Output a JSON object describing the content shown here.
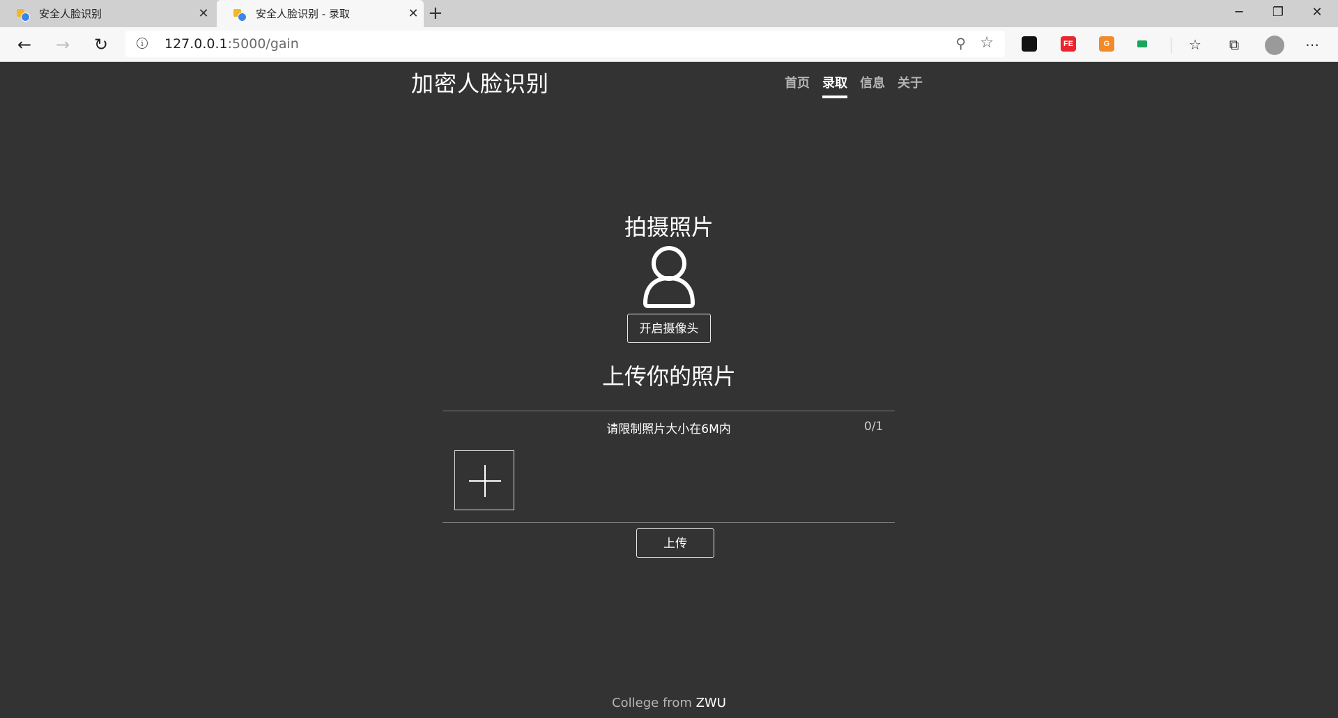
{
  "browser": {
    "tabs": [
      {
        "title": "安全人脸识别"
      },
      {
        "title": "安全人脸识别 - 录取"
      }
    ],
    "url_host": "127.0.0.1",
    "url_path": ":5000/gain",
    "extensions": [
      {
        "name": "tampermonkey-icon",
        "color": "#111111",
        "text": ""
      },
      {
        "name": "fe-helper-icon",
        "color": "#e8262d",
        "text": "FE"
      },
      {
        "name": "google-translate-icon",
        "color": "#f08a2a",
        "text": "G"
      },
      {
        "name": "green-extension-icon",
        "color": "#19a55a",
        "text": ""
      }
    ]
  },
  "site": {
    "title": "加密人脸识别",
    "nav": [
      {
        "label": "首页"
      },
      {
        "label": "录取"
      },
      {
        "label": "信息"
      },
      {
        "label": "关于"
      }
    ],
    "active_nav": "录取"
  },
  "capture": {
    "title": "拍摄照片",
    "open_camera_label": "开启摄像头"
  },
  "upload": {
    "title": "上传你的照片",
    "limit_text": "请限制照片大小在6M内",
    "count": "0/1",
    "submit_label": "上传"
  },
  "footer": {
    "prefix": "College from ",
    "org": "ZWU"
  }
}
